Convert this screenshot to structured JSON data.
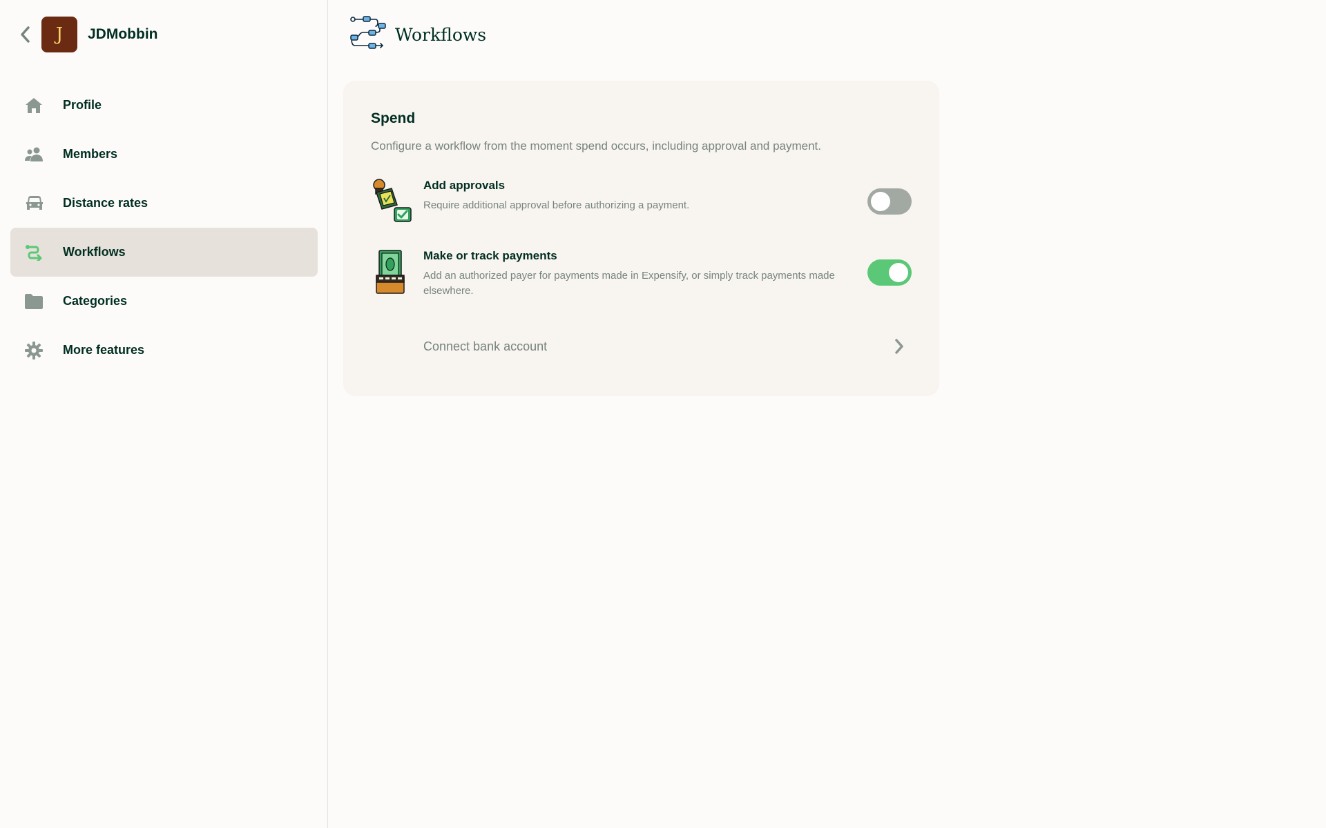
{
  "sidebar": {
    "workspace_name": "JDMobbin",
    "avatar_letter": "J",
    "items": [
      {
        "label": "Profile",
        "icon": "home-icon",
        "active": false
      },
      {
        "label": "Members",
        "icon": "users-icon",
        "active": false
      },
      {
        "label": "Distance rates",
        "icon": "car-icon",
        "active": false
      },
      {
        "label": "Workflows",
        "icon": "workflow-icon",
        "active": true
      },
      {
        "label": "Categories",
        "icon": "folder-icon",
        "active": false
      },
      {
        "label": "More features",
        "icon": "gear-icon",
        "active": false
      }
    ]
  },
  "header": {
    "title": "Workflows",
    "icon": "workflows-illustration-icon"
  },
  "spend": {
    "title": "Spend",
    "description": "Configure a workflow from the moment spend occurs, including approval and payment.",
    "approvals": {
      "title": "Add approvals",
      "description": "Require additional approval before authorizing a payment.",
      "enabled": false
    },
    "payments": {
      "title": "Make or track payments",
      "description": "Add an authorized payer for payments made in Expensify, or simply track payments made elsewhere.",
      "enabled": true
    },
    "connect_bank": {
      "label": "Connect bank account"
    }
  },
  "colors": {
    "accent_green": "#5bc877",
    "toggle_off": "#a2a9a3",
    "active_nav_bg": "#e6e1da",
    "avatar_bg": "#6b2a12"
  }
}
